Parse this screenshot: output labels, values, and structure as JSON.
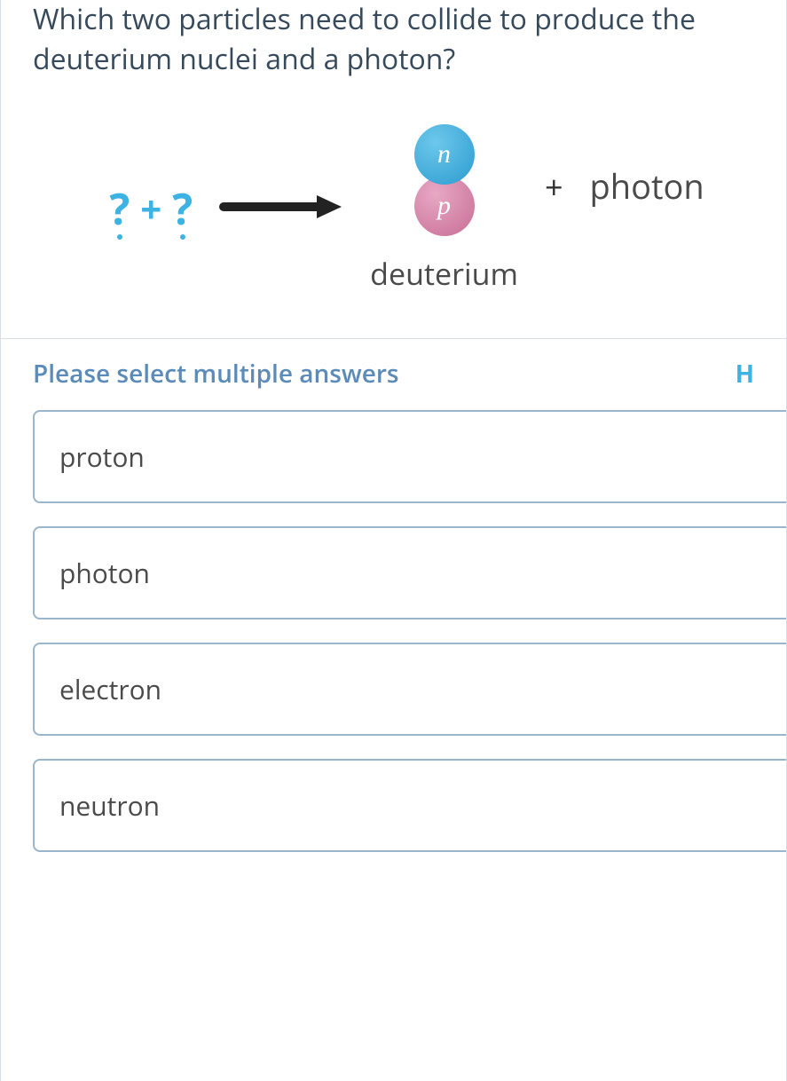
{
  "question": {
    "text": "Which two particles need to collide to produce the deuterium nuclei and a photon?"
  },
  "diagram": {
    "reactant1": "?",
    "reactant_plus": "+",
    "reactant2": "?",
    "neutron_label": "n",
    "proton_label": "p",
    "deuterium_label": "deuterium",
    "product_plus": "+",
    "photon_label": "photon"
  },
  "answers": {
    "instruction": "Please select multiple answers",
    "help": "H",
    "options": [
      {
        "label": "proton"
      },
      {
        "label": "photon"
      },
      {
        "label": "electron"
      },
      {
        "label": "neutron"
      }
    ]
  }
}
